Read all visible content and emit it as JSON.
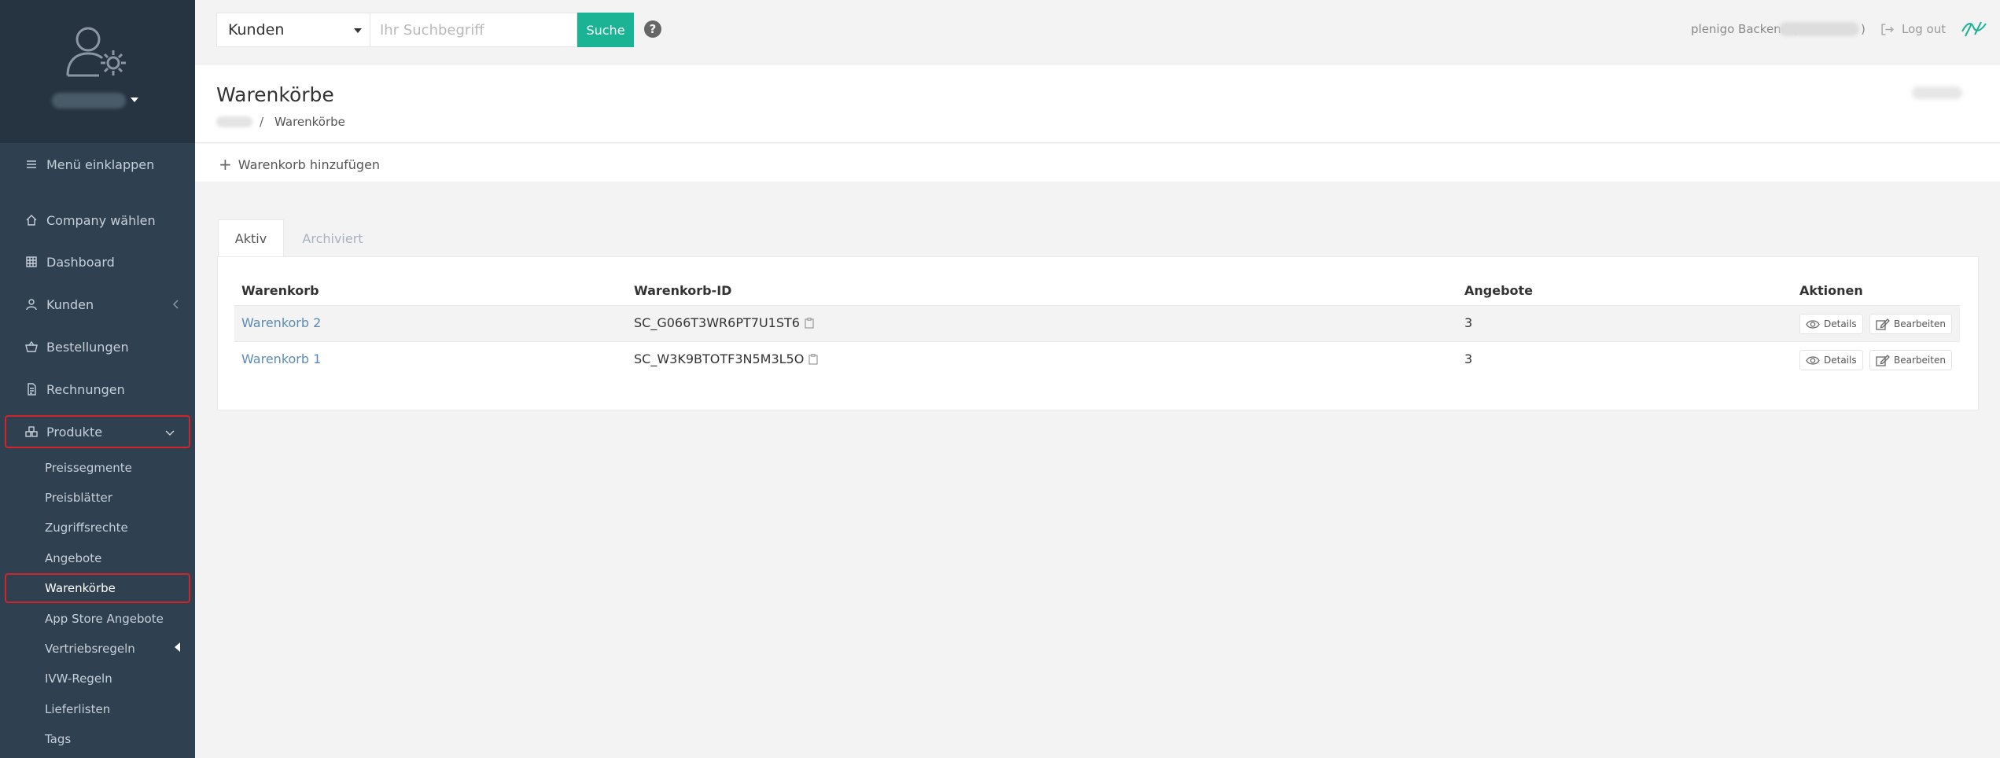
{
  "sidebar": {
    "collapse_label": "Menü einklappen",
    "items": [
      {
        "label": "Company wählen"
      },
      {
        "label": "Dashboard"
      },
      {
        "label": "Kunden"
      },
      {
        "label": "Bestellungen"
      },
      {
        "label": "Rechnungen"
      },
      {
        "label": "Produkte"
      }
    ],
    "subitems": [
      {
        "label": "Preissegmente"
      },
      {
        "label": "Preisblätter"
      },
      {
        "label": "Zugriffsrechte"
      },
      {
        "label": "Angebote"
      },
      {
        "label": "Warenkörbe"
      },
      {
        "label": "App Store Angebote"
      },
      {
        "label": "Vertriebsregeln"
      },
      {
        "label": "IVW-Regeln"
      },
      {
        "label": "Lieferlisten"
      },
      {
        "label": "Tags"
      }
    ]
  },
  "topbar": {
    "search_scope": "Kunden",
    "search_placeholder": "Ihr Suchbegriff",
    "search_button": "Suche",
    "backend_label": "plenigo Backend (",
    "paren_close": ")",
    "logout_label": "Log out"
  },
  "header": {
    "title": "Warenkörbe",
    "breadcrumb_sep": "/",
    "breadcrumb_current": "Warenkörbe",
    "add_label": "Warenkorb hinzufügen"
  },
  "tabs": [
    {
      "label": "Aktiv"
    },
    {
      "label": "Archiviert"
    }
  ],
  "table": {
    "headers": [
      "Warenkorb",
      "Warenkorb-ID",
      "Angebote",
      "Aktionen"
    ],
    "rows": [
      {
        "name": "Warenkorb 2",
        "id": "SC_G066T3WR6PT7U1ST6",
        "offers": "3"
      },
      {
        "name": "Warenkorb 1",
        "id": "SC_W3K9BTOTF3N5M3L5O",
        "offers": "3"
      }
    ],
    "details_label": "Details",
    "edit_label": "Bearbeiten"
  },
  "colors": {
    "sidebar_bg": "#2f4050",
    "accent": "#1ab394",
    "highlight_border": "#d0252b",
    "link": "#5b8bb5"
  }
}
